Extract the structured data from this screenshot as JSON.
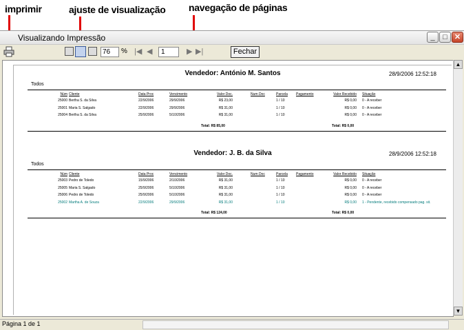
{
  "annotations": {
    "print": "imprimir",
    "view": "ajuste de visualização",
    "nav": "navegação de páginas"
  },
  "window": {
    "title": "Visualizando Impressão",
    "min": "_",
    "max": "□",
    "close": "✕"
  },
  "toolbar": {
    "zoom": "76",
    "percent": "%",
    "page": "1",
    "close_label": "Fechar",
    "first": "|◀",
    "prev": "◀",
    "next": "▶",
    "last": "▶|"
  },
  "icons": [
    "printer-icon",
    "single-page-icon",
    "page-width-icon",
    "multi-page-icon"
  ],
  "status": {
    "page_info": "Página 1 de 1"
  },
  "columns": [
    "Núm",
    "Cliente",
    "Data Proc",
    "Vencimento",
    "Valor Doc.",
    "Num Doc",
    "Parcela",
    "Pagamento",
    "Valor Recebido",
    "Situação"
  ],
  "sections": [
    {
      "vendedor": "Vendedor: António M. Santos",
      "date": "28/9/2006 12:52:18",
      "group": "Todos",
      "rows": [
        {
          "num": "25000",
          "cliente": "Bertha S. da Silva",
          "data": "22/9/2006",
          "venc": "29/9/2006",
          "valor": "R$ 23,00",
          "numdoc": "",
          "parcela": "1 / 10",
          "pagamento": "",
          "recebido": "R$ 0,00",
          "situacao": "0 - A receber",
          "highlight": false
        },
        {
          "num": "25001",
          "cliente": "Maria S. Salgado",
          "data": "22/9/2006",
          "venc": "29/9/2006",
          "valor": "R$ 31,00",
          "numdoc": "",
          "parcela": "1 / 10",
          "pagamento": "",
          "recebido": "R$ 0,00",
          "situacao": "0 - A receber",
          "highlight": false
        },
        {
          "num": "25004",
          "cliente": "Bertha S. da Silva",
          "data": "25/9/2006",
          "venc": "5/10/2006",
          "valor": "R$ 31,00",
          "numdoc": "",
          "parcela": "1 / 10",
          "pagamento": "",
          "recebido": "R$ 0,00",
          "situacao": "0 - A receber",
          "highlight": false
        }
      ],
      "total_doc": "Total: R$ 85,00",
      "total_rec": "Total: R$ 0,00"
    },
    {
      "vendedor": "Vendedor: J. B. da Silva",
      "date": "28/9/2006 12:52:18",
      "group": "Todos",
      "rows": [
        {
          "num": "25003",
          "cliente": "Pedro de Toledo",
          "data": "15/9/2006",
          "venc": "2/10/2006",
          "valor": "R$ 31,00",
          "numdoc": "",
          "parcela": "1 / 10",
          "pagamento": "",
          "recebido": "R$ 0,00",
          "situacao": "0 - A receber",
          "highlight": false
        },
        {
          "num": "25005",
          "cliente": "Maria S. Salgado",
          "data": "25/9/2006",
          "venc": "5/10/2006",
          "valor": "R$ 31,00",
          "numdoc": "",
          "parcela": "1 / 10",
          "pagamento": "",
          "recebido": "R$ 0,00",
          "situacao": "0 - A receber",
          "highlight": false
        },
        {
          "num": "25006",
          "cliente": "Pedro de Toledo",
          "data": "25/9/2006",
          "venc": "5/10/2006",
          "valor": "R$ 31,00",
          "numdoc": "",
          "parcela": "1 / 10",
          "pagamento": "",
          "recebido": "R$ 0,00",
          "situacao": "0 - A receber",
          "highlight": false
        },
        {
          "num": "25002",
          "cliente": "Martha A. de Souza",
          "data": "22/9/2006",
          "venc": "29/9/2006",
          "valor": "R$ 31,00",
          "numdoc": "",
          "parcela": "1 / 10",
          "pagamento": "",
          "recebido": "R$ 0,00",
          "situacao": "1 - Pendente, recebido compensado pag. sit.",
          "highlight": true
        }
      ],
      "total_doc": "Total: R$ 124,00",
      "total_rec": "Total: R$ 0,00"
    }
  ],
  "colors": {
    "highlight": "#007a7a",
    "arrow": "#e00000"
  }
}
